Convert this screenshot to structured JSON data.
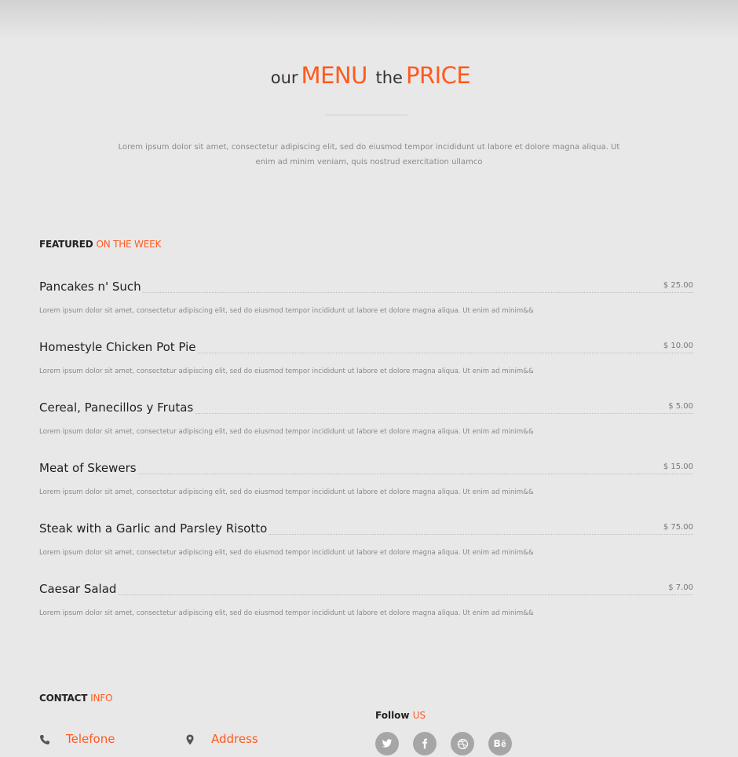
{
  "hero": {
    "title_small_1": "our",
    "title_big_1": "MENU",
    "title_small_2": "the",
    "title_big_2": "PRICE",
    "lede": "Lorem ipsum dolor sit amet, consectetur adipiscing elit, sed do eiusmod tempor incididunt ut labore et dolore magna aliqua. Ut enim ad minim veniam, quis nostrud exercitation ullamco"
  },
  "featured": {
    "heading_main": "FEATURED",
    "heading_accent": "ON THE WEEK"
  },
  "menu": {
    "items": [
      {
        "name": "Pancakes n' Such",
        "price": "$ 25.00",
        "desc": "Lorem ipsum dolor sit amet, consectetur adipiscing elit, sed do eiusmod tempor incididunt ut labore et dolore magna aliqua. Ut enim ad minim&&"
      },
      {
        "name": "Homestyle Chicken Pot Pie",
        "price": "$ 10.00",
        "desc": "Lorem ipsum dolor sit amet, consectetur adipiscing elit, sed do eiusmod tempor incididunt ut labore et dolore magna aliqua. Ut enim ad minim&&"
      },
      {
        "name": "Cereal, Panecillos y Frutas",
        "price": "$ 5.00",
        "desc": "Lorem ipsum dolor sit amet, consectetur adipiscing elit, sed do eiusmod tempor incididunt ut labore et dolore magna aliqua. Ut enim ad minim&&"
      },
      {
        "name": "Meat of Skewers",
        "price": "$ 15.00",
        "desc": "Lorem ipsum dolor sit amet, consectetur adipiscing elit, sed do eiusmod tempor incididunt ut labore et dolore magna aliqua. Ut enim ad minim&&"
      },
      {
        "name": "Steak with a Garlic and Parsley Risotto",
        "price": "$ 75.00",
        "desc": "Lorem ipsum dolor sit amet, consectetur adipiscing elit, sed do eiusmod tempor incididunt ut labore et dolore magna aliqua. Ut enim ad minim&&"
      },
      {
        "name": "Caesar Salad",
        "price": "$ 7.00",
        "desc": "Lorem ipsum dolor sit amet, consectetur adipiscing elit, sed do eiusmod tempor incididunt ut labore et dolore magna aliqua. Ut enim ad minim&&"
      }
    ]
  },
  "contact": {
    "heading_main": "CONTACT",
    "heading_accent": "INFO",
    "phone": {
      "label": "Telefone",
      "icon": "phone-icon"
    },
    "address": {
      "label": "Address",
      "icon": "map-marker-icon"
    }
  },
  "follow": {
    "heading_main": "Follow",
    "heading_accent": "US",
    "networks": [
      "twitter-icon",
      "facebook-icon",
      "dribbble-icon",
      "behance-icon"
    ]
  },
  "colors": {
    "accent": "#ff5a1f",
    "background": "#e8e8e8",
    "text_dark": "#222222",
    "text_muted": "#888888",
    "social_circle": "#a6a6a6"
  }
}
